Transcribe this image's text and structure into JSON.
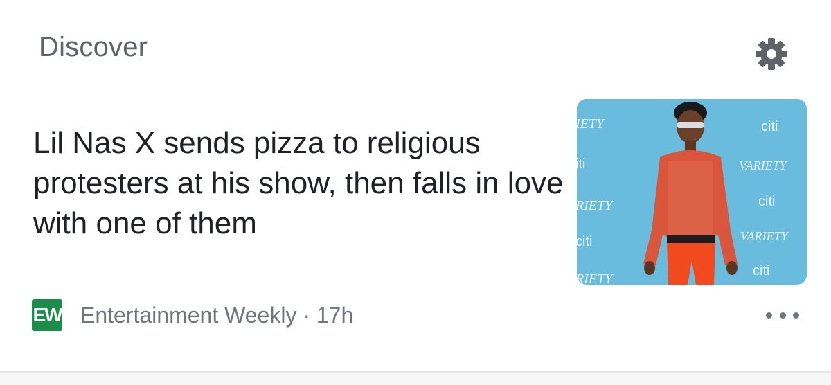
{
  "header": {
    "title": "Discover",
    "settings_icon": "gear-icon"
  },
  "card": {
    "headline": "Lil Nas X sends pizza to religious protesters at his show, then falls in love with one of them",
    "source": {
      "logo_text": "EW",
      "name": "Entertainment Weekly",
      "separator": "·",
      "age": "17h"
    },
    "image_backdrop": {
      "left_column": [
        "IETY",
        "iti",
        "RIETY",
        "citi",
        "RIETY"
      ],
      "right_column": [
        "citi",
        "VARIETY",
        "citi",
        "VARIETY",
        "citi"
      ]
    },
    "more_icon": "more-horizontal-icon"
  },
  "colors": {
    "title_gray": "#5f6368",
    "headline": "#202124",
    "source_gray": "#70757a",
    "ew_green": "#1b8d4a",
    "backdrop_blue": "#62b7dc"
  }
}
